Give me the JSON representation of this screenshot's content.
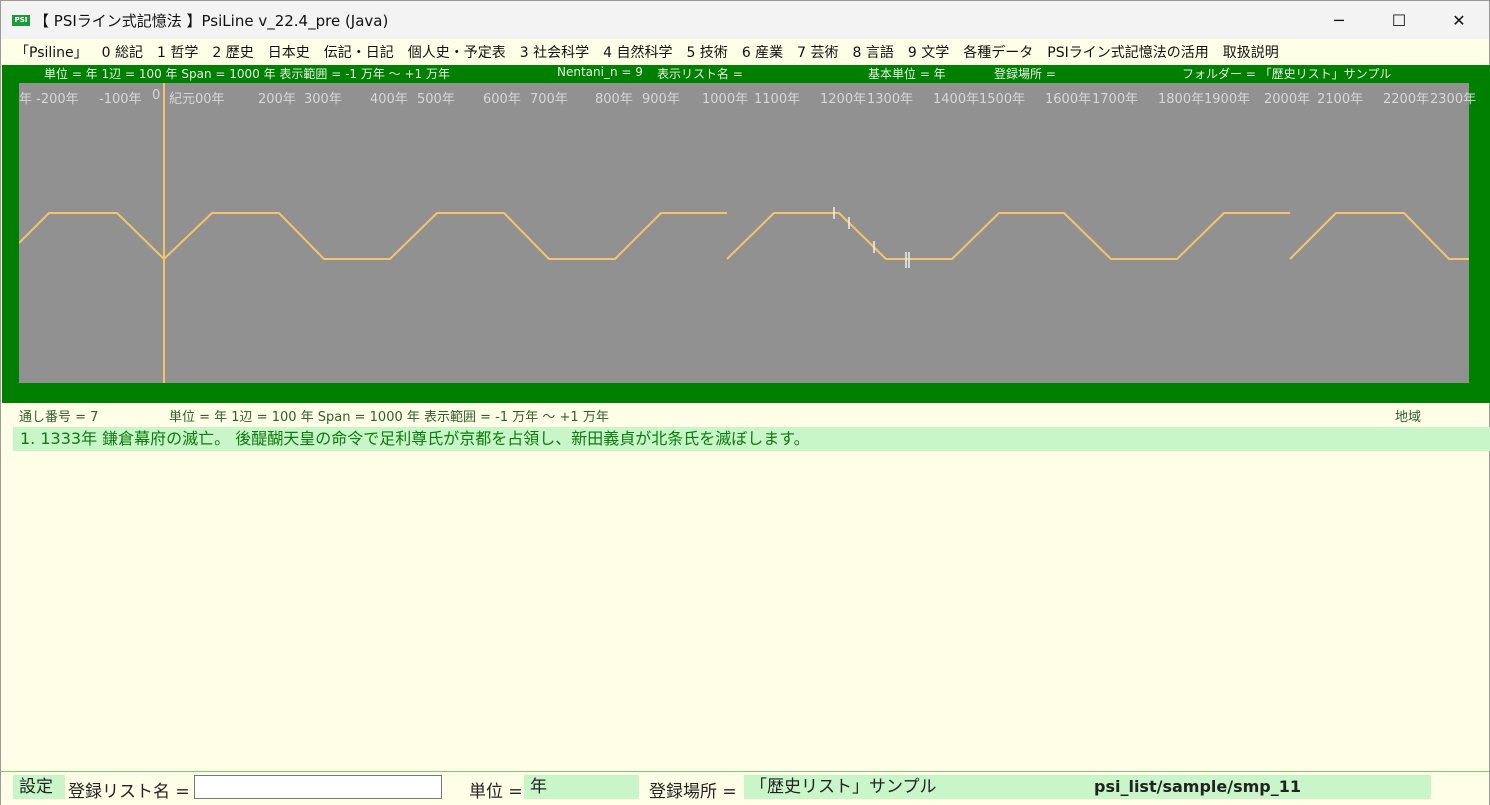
{
  "window": {
    "title": "【 PSIライン式記憶法 】PsiLine v_22.4_pre (Java)",
    "icon_text": "PSI",
    "minimize": "─",
    "maximize": "☐",
    "close": "✕"
  },
  "menu": [
    "「Psiline」",
    "0 総記",
    "1 哲学",
    "2 歴史",
    "日本史",
    "伝記・日記",
    "個人史・予定表",
    "3 社会科学",
    "4 自然科学",
    "5 技術",
    "6 産業",
    "7 芸術",
    "8 言語",
    "9 文学",
    "各種データ",
    "PSIライン式記憶法の活用",
    "取扱説明"
  ],
  "info": {
    "unit_span": "単位 = 年  1辺 = 100 年  Span = 1000 年  表示範囲 = -1 万年 ～ +1 万年",
    "nentani": "Nentani_n = 9",
    "list_name": "表示リスト名 =",
    "base_unit": "基本単位 = 年",
    "location": "登録場所 =",
    "folder": "フォルダー = 「歴史リスト」サンプル"
  },
  "year_labels": [
    "年 -200年",
    "-100年",
    "0",
    "紀元00年",
    "200年",
    "300年",
    "400年",
    "500年",
    "600年",
    "700年",
    "800年",
    "900年",
    "1000年",
    "1100年",
    "1200年",
    "1300年",
    "1400年",
    "1500年",
    "1600年",
    "1700年",
    "1800年",
    "1900年",
    "2000年",
    "2100年",
    "2200年",
    "2300年"
  ],
  "details": {
    "serial": "通し番号 = 7",
    "unit_span": "単位 = 年  1辺 = 100 年  Span = 1000 年  表示範囲 = -1 万年 ～ +1 万年",
    "region": "地域"
  },
  "entry": {
    "text": "1. 1333年 鎌倉幕府の滅亡。 後醍醐天皇の命令で足利尊氏が京都を占領し、新田義貞が北条氏を滅ぼします。"
  },
  "status": {
    "settings": "設定",
    "list_name_label": "登録リスト名 =",
    "list_name_value": "",
    "unit_label": "単位 =",
    "unit_value": "年",
    "location_label": "登録場所 =",
    "location_value": "「歴史リスト」サンプル",
    "path_value": "psi_list/sample/smp_11"
  },
  "colors": {
    "panel": "#008000",
    "plot": "#919191",
    "line": "#f5c46a",
    "entry_bg": "#c8f6c8"
  }
}
